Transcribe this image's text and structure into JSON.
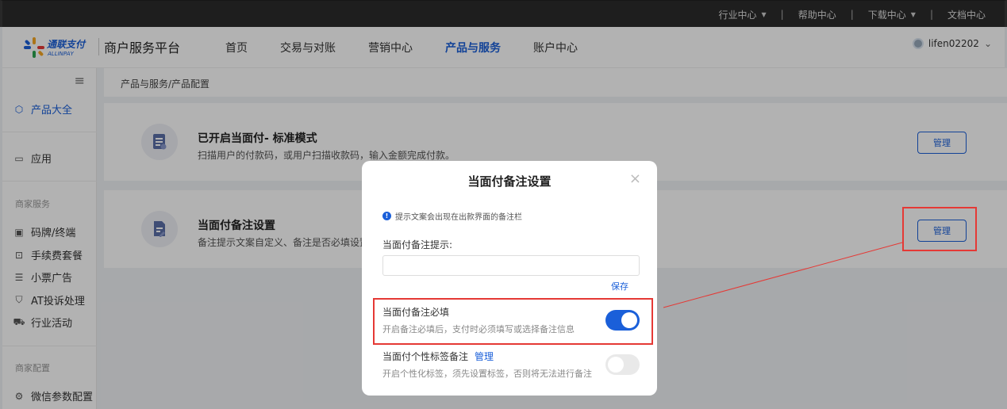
{
  "topbar": {
    "items": [
      {
        "label": "行业中心",
        "has_caret": true
      },
      {
        "label": "帮助中心",
        "has_caret": false
      },
      {
        "label": "下载中心",
        "has_caret": true
      },
      {
        "label": "文档中心",
        "has_caret": false
      }
    ],
    "separator": "|",
    "caret": "▼"
  },
  "header": {
    "logo": {
      "name": "通联支付",
      "sub": "ALLINPAY"
    },
    "platform_title": "商户服务平台",
    "nav": [
      {
        "label": "首页",
        "active": false
      },
      {
        "label": "交易与对账",
        "active": false
      },
      {
        "label": "营销中心",
        "active": false
      },
      {
        "label": "产品与服务",
        "active": true
      },
      {
        "label": "账户中心",
        "active": false
      }
    ],
    "user": {
      "name": "lifen02202",
      "caret": "⌄"
    }
  },
  "sidebar": {
    "menu_icon": "≡",
    "items_top": [
      {
        "label": "产品大全",
        "icon": "cube-icon",
        "glyph": "⬡",
        "active": true
      },
      {
        "label": "应用",
        "icon": "box-icon",
        "glyph": "▭",
        "active": false
      }
    ],
    "group_merchant": "商家服务",
    "items_merchant": [
      {
        "label": "码牌/终端",
        "icon": "terminal-icon",
        "glyph": "▣"
      },
      {
        "label": "手续费套餐",
        "icon": "package-icon",
        "glyph": "⊡"
      },
      {
        "label": "小票广告",
        "icon": "receipt-icon",
        "glyph": "☰"
      },
      {
        "label": "AT投诉处理",
        "icon": "shield-icon",
        "glyph": "⛉"
      },
      {
        "label": "行业活动",
        "icon": "cart-icon",
        "glyph": "⛟"
      }
    ],
    "group_config": "商家配置",
    "items_config": [
      {
        "label": "微信参数配置",
        "icon": "settings-icon",
        "glyph": "⚙"
      }
    ]
  },
  "breadcrumb": "产品与服务/产品配置",
  "cards": [
    {
      "title": "已开启当面付- 标准模式",
      "desc": "扫描用户的付款码，或用户扫描收款码，输入金额完成付款。",
      "button": "管理"
    },
    {
      "title": "当面付备注设置",
      "desc": "备注提示文案自定义、备注是否必填设置",
      "button": "管理"
    }
  ],
  "modal": {
    "title": "当面付备注设置",
    "close": "×",
    "tip": "提示文案会出现在出款界面的备注栏",
    "tip_icon": "!",
    "field_label": "当面付备注提示:",
    "field_value": "",
    "save": "保存",
    "required_title": "当面付备注必填",
    "required_desc": "开启备注必填后，支付时必须填写或选择备注信息",
    "required_on": true,
    "tag_title": "当面付个性标签备注",
    "tag_manage": "管理",
    "tag_desc": "开启个性化标签，须先设置标签，否则将无法进行备注",
    "tag_on": false
  },
  "colors": {
    "accent": "#1a5fd9",
    "highlight": "#e53935",
    "topbar": "#2b2b2b"
  }
}
